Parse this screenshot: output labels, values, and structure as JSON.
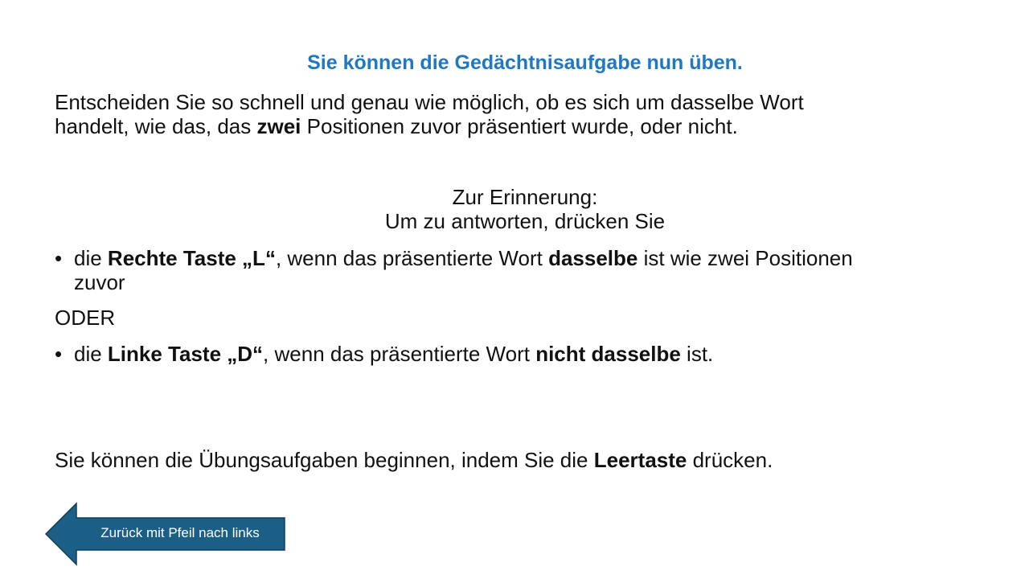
{
  "title": "Sie können die Gedächtnisaufgabe nun üben.",
  "intro": {
    "line1": "Entscheiden Sie so schnell und genau wie möglich, ob es sich um dasselbe Wort",
    "line2_a": "handelt, wie das, das ",
    "line2_b": "zwei",
    "line2_c": " Positionen zuvor präsentiert wurde, oder nicht."
  },
  "reminder": {
    "heading": "Zur Erinnerung:",
    "subheading": "Um zu antworten, drücken Sie"
  },
  "bullet1": {
    "mark": "•",
    "a": "die ",
    "b": "Rechte Taste „L“",
    "c": ", wenn das präsentierte Wort ",
    "d": "dasselbe",
    "e": " ist wie zwei Positionen",
    "f": "zuvor"
  },
  "oder": "ODER",
  "bullet2": {
    "mark": "•",
    "a": "die ",
    "b": "Linke Taste „D“",
    "c": ", wenn das präsentierte Wort ",
    "d": "nicht dasselbe",
    "e": " ist."
  },
  "start": {
    "a": "Sie können die Übungsaufgaben beginnen, indem Sie die ",
    "b": "Leertaste",
    "c": " drücken."
  },
  "back_button": {
    "label": "Zurück mit Pfeil nach links",
    "icon": "left-arrow-icon",
    "fill": "#1b5f86",
    "stroke": "#0f3e5a"
  },
  "colors": {
    "title": "#1f78c1",
    "text": "#111111",
    "background": "#ffffff"
  }
}
